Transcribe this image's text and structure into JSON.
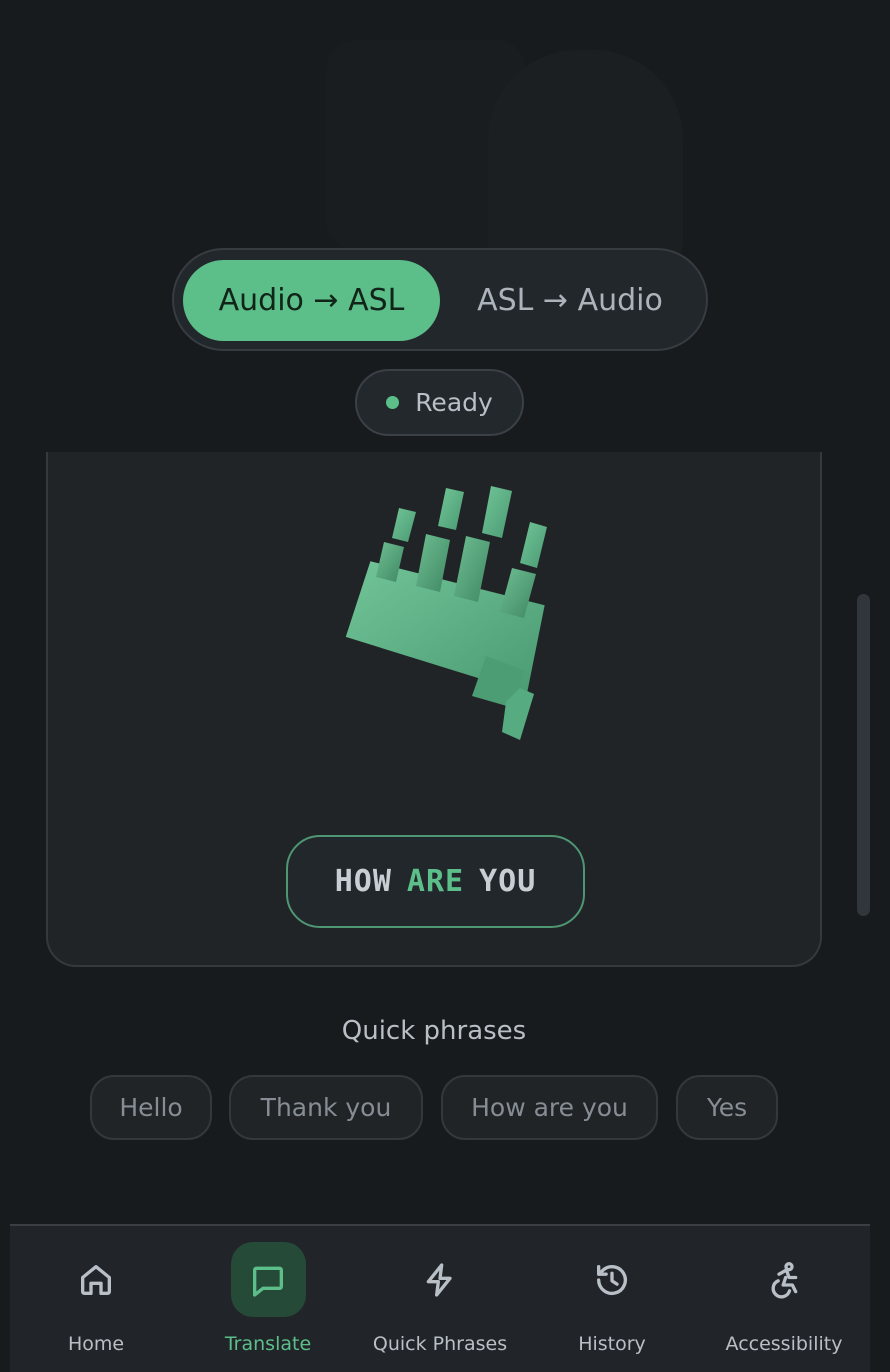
{
  "mode_toggle": {
    "active_label": "Audio → ASL",
    "inactive_label": "ASL → Audio"
  },
  "status": {
    "label": "Ready",
    "color": "#5cbf8a"
  },
  "caption": {
    "words": [
      "HOW",
      "ARE",
      "YOU"
    ],
    "active_word": "ARE"
  },
  "quick_phrases": {
    "title": "Quick phrases",
    "items": [
      "Hello",
      "Thank you",
      "How are you",
      "Yes"
    ]
  },
  "bottom_nav": {
    "items": [
      {
        "label": "Home",
        "icon": "home-icon"
      },
      {
        "label": "Translate",
        "icon": "chat-bubble-icon",
        "active": true
      },
      {
        "label": "Quick Phrases",
        "icon": "lightning-icon"
      },
      {
        "label": "History",
        "icon": "history-icon"
      },
      {
        "label": "Accessibility",
        "icon": "accessibility-icon"
      }
    ]
  },
  "colors": {
    "accent": "#5cbf8a",
    "background": "#171b1e",
    "surface": "#202427"
  }
}
